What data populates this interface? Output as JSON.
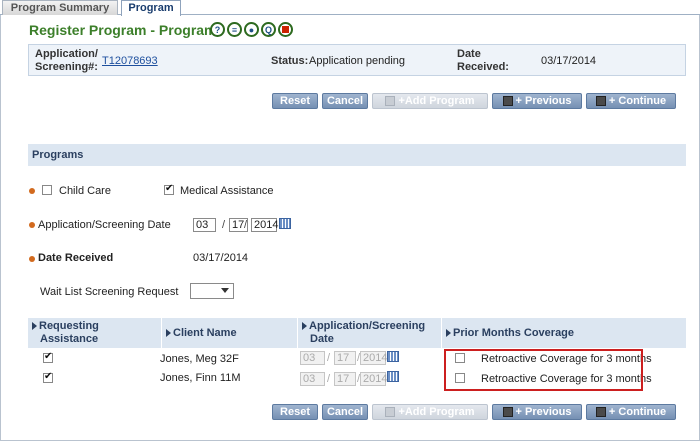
{
  "tabs": [
    {
      "label": "Program Summary",
      "active": false
    },
    {
      "label": "Program",
      "active": true
    }
  ],
  "header": {
    "title": "Register Program - Program",
    "icons": [
      "help-icon",
      "notes-icon",
      "person-icon",
      "search-icon",
      "stop-icon"
    ],
    "icon_glyphs": [
      "?",
      "≡",
      "●",
      "Q",
      ""
    ]
  },
  "info": {
    "app_label": "Application/",
    "app_label2": "Screening#:",
    "app_value": "T12078693",
    "status_label": "Status:",
    "status_value": "Application pending",
    "date_label": "Date",
    "date_label2": "Received:",
    "date_value": "03/17/2014"
  },
  "buttons": {
    "reset": "Reset",
    "cancel": "Cancel",
    "add_program": "+Add Program",
    "previous": "+ Previous",
    "continue": "+ Continue"
  },
  "programs": {
    "section_title": "Programs",
    "child_care": "Child Care",
    "child_care_checked": false,
    "medical_assistance": "Medical Assistance",
    "medical_assistance_checked": true,
    "app_date_label": "Application/Screening Date",
    "app_date_mm": "03",
    "app_date_dd": "17",
    "app_date_yyyy": "2014",
    "date_received_label": "Date Received",
    "date_received_value": "03/17/2014",
    "waitlist_label": "Wait List Screening Request",
    "waitlist_value": ""
  },
  "table": {
    "headers": {
      "requesting1": "Requesting",
      "requesting2": "Assistance",
      "client": "Client Name",
      "appdate1": "Application/Screening",
      "appdate2": "Date",
      "prior": "Prior Months Coverage"
    },
    "rows": [
      {
        "checked": true,
        "client": "Jones, Meg 32F",
        "mm": "03",
        "dd": "17",
        "yyyy": "2014",
        "retro": "Retroactive Coverage for 3 months",
        "retro_checked": false
      },
      {
        "checked": true,
        "client": "Jones, Finn 11M",
        "mm": "03",
        "dd": "17",
        "yyyy": "2014",
        "retro": "Retroactive Coverage for 3 months",
        "retro_checked": false
      }
    ]
  },
  "colors": {
    "title_green": "#3c7f2a",
    "section_bg": "#dce6f1",
    "button_blue": "#7590b3",
    "highlight_red": "#cc1f1f"
  }
}
